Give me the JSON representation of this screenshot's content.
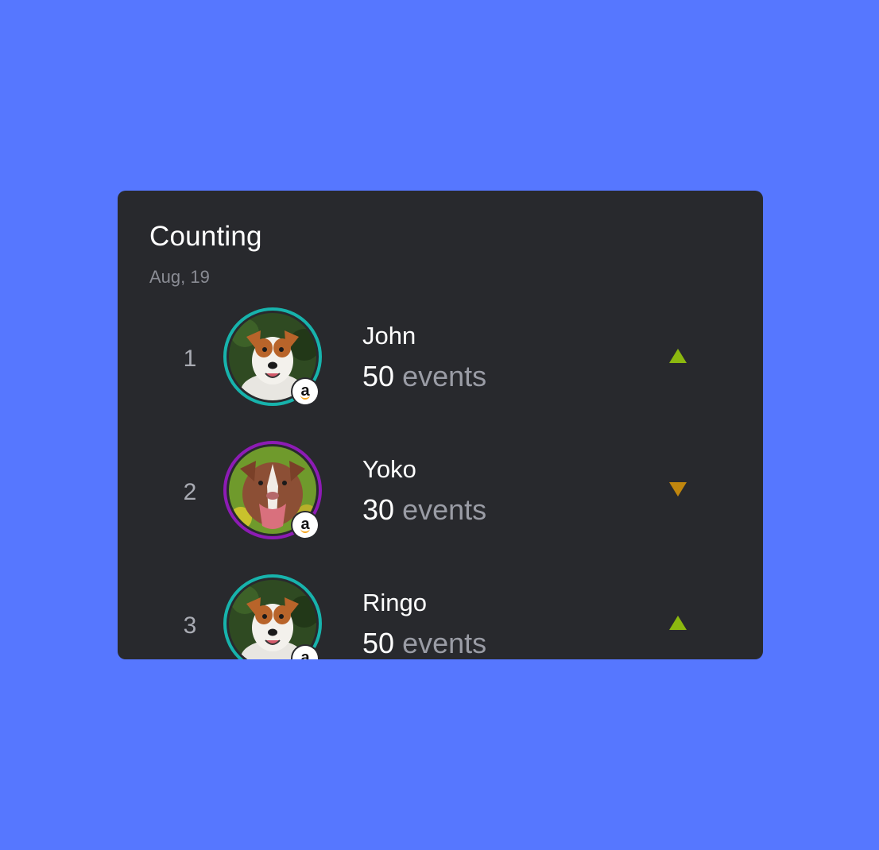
{
  "card": {
    "title": "Counting",
    "date": "Aug, 19"
  },
  "rows": [
    {
      "rank": "1",
      "name": "John",
      "count": "50",
      "unit": "events",
      "ring_color": "#17b3ac",
      "trend": "up",
      "trend_color": "#8cb80f",
      "badge_icon": "amazon-icon",
      "badge_letter": "a"
    },
    {
      "rank": "2",
      "name": "Yoko",
      "count": "30",
      "unit": "events",
      "ring_color": "#8d1bb5",
      "trend": "down",
      "trend_color": "#c0860e",
      "badge_icon": "amazon-icon",
      "badge_letter": "a"
    },
    {
      "rank": "3",
      "name": "Ringo",
      "count": "50",
      "unit": "events",
      "ring_color": "#17b3ac",
      "trend": "up",
      "trend_color": "#8cb80f",
      "badge_icon": "amazon-icon",
      "badge_letter": "a"
    }
  ]
}
